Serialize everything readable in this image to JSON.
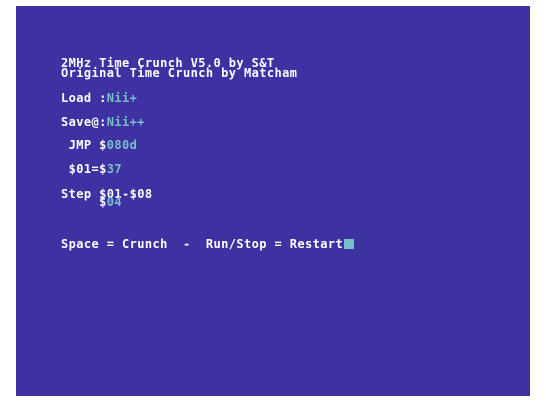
{
  "header": {
    "title_line": "2MHz Time Crunch V5.0 by S&T",
    "credit_line": "Original Time Crunch by Matcham"
  },
  "load": {
    "label": "Load :",
    "value": "Nii+"
  },
  "save": {
    "label": "Save@:",
    "value": "Nii++"
  },
  "jmp": {
    "label": " JMP $",
    "value": "080d"
  },
  "zp": {
    "label": " $01=$",
    "value": "37"
  },
  "step": {
    "label": "Step ",
    "range": "$01-$08",
    "current_prefix": "     $",
    "current_value": "04"
  },
  "prompt": {
    "text": "Space = Crunch  -  Run/Stop = Restart"
  },
  "colors": {
    "background": "#3e31a2",
    "text": "#ffffff",
    "highlight": "#7abfc7"
  }
}
